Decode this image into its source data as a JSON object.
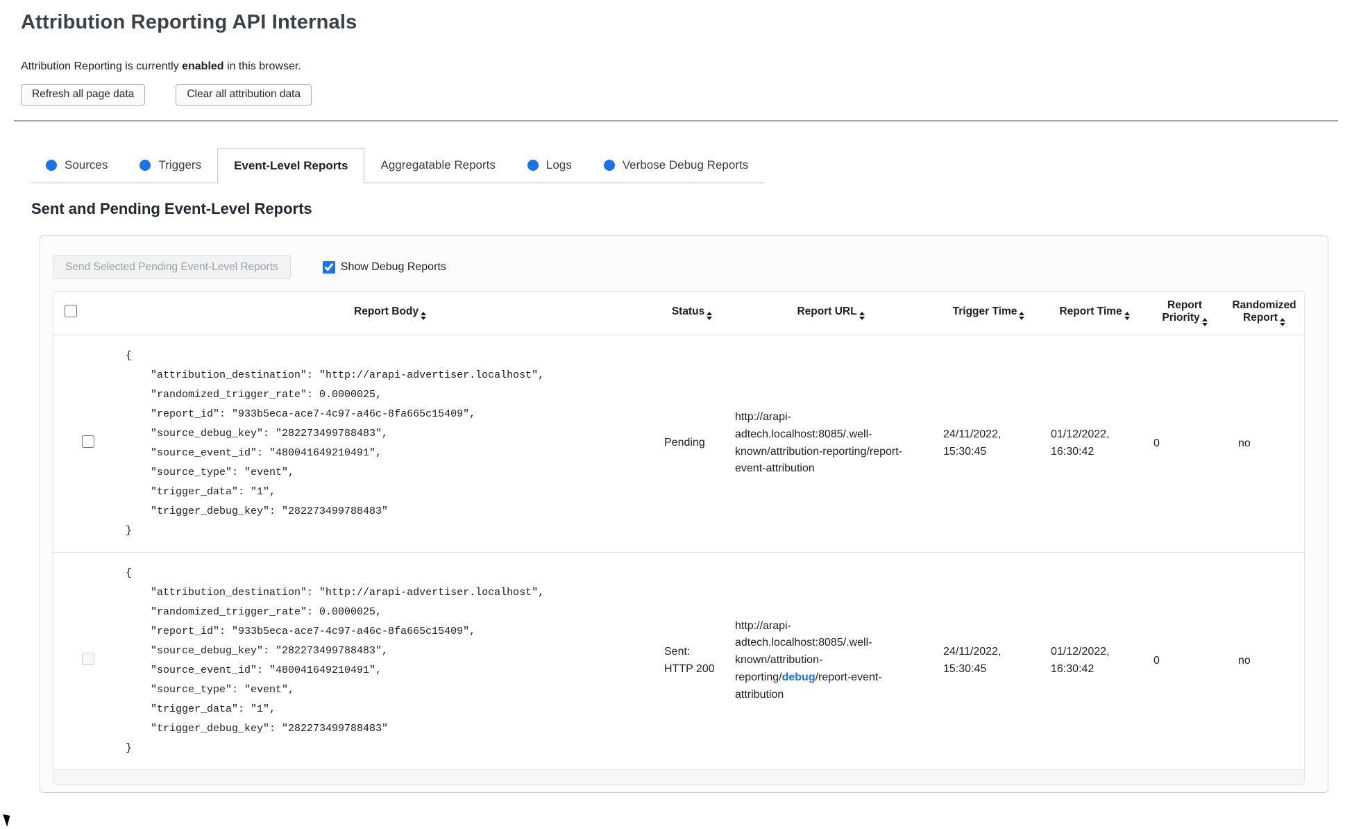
{
  "page": {
    "title": "Attribution Reporting API Internals",
    "intro_prefix": "Attribution Reporting is currently ",
    "intro_bold": "enabled",
    "intro_suffix": " in this browser.",
    "refresh_button": "Refresh all page data",
    "clear_button": "Clear all attribution data"
  },
  "tabs": [
    {
      "label": "Sources",
      "has_dot": true,
      "active": false
    },
    {
      "label": "Triggers",
      "has_dot": true,
      "active": false
    },
    {
      "label": "Event-Level Reports",
      "has_dot": false,
      "active": true
    },
    {
      "label": "Aggregatable Reports",
      "has_dot": false,
      "active": false
    },
    {
      "label": "Logs",
      "has_dot": true,
      "active": false
    },
    {
      "label": "Verbose Debug Reports",
      "has_dot": true,
      "active": false
    }
  ],
  "section": {
    "heading": "Sent and Pending Event-Level Reports",
    "send_button": "Send Selected Pending Event-Level Reports",
    "send_button_disabled": true,
    "show_debug_label": "Show Debug Reports",
    "show_debug_checked": true
  },
  "table": {
    "headers": {
      "body": "Report Body",
      "status": "Status",
      "url": "Report URL",
      "trigger_time": "Trigger Time",
      "report_time": "Report Time",
      "priority": "Report Priority",
      "randomized": "Randomized Report"
    },
    "rows": [
      {
        "selectable": true,
        "body": "{\n    \"attribution_destination\": \"http://arapi-advertiser.localhost\",\n    \"randomized_trigger_rate\": 0.0000025,\n    \"report_id\": \"933b5eca-ace7-4c97-a46c-8fa665c15409\",\n    \"source_debug_key\": \"282273499788483\",\n    \"source_event_id\": \"480041649210491\",\n    \"source_type\": \"event\",\n    \"trigger_data\": \"1\",\n    \"trigger_debug_key\": \"282273499788483\"\n}",
        "status": "Pending",
        "url_prefix": "http://arapi-adtech.localhost:8085/.well-known/attribution-reporting/report-event-attribution",
        "url_debug": "",
        "url_suffix": "",
        "trigger_time": "24/11/2022, 15:30:45",
        "report_time": "01/12/2022, 16:30:42",
        "priority": "0",
        "randomized": "no"
      },
      {
        "selectable": false,
        "body": "{\n    \"attribution_destination\": \"http://arapi-advertiser.localhost\",\n    \"randomized_trigger_rate\": 0.0000025,\n    \"report_id\": \"933b5eca-ace7-4c97-a46c-8fa665c15409\",\n    \"source_debug_key\": \"282273499788483\",\n    \"source_event_id\": \"480041649210491\",\n    \"source_type\": \"event\",\n    \"trigger_data\": \"1\",\n    \"trigger_debug_key\": \"282273499788483\"\n}",
        "status": "Sent: HTTP 200",
        "url_prefix": "http://arapi-adtech.localhost:8085/.well-known/attribution-reporting/",
        "url_debug": "debug",
        "url_suffix": "/report-event-attribution",
        "trigger_time": "24/11/2022, 15:30:45",
        "report_time": "01/12/2022, 16:30:42",
        "priority": "0",
        "randomized": "no"
      }
    ]
  },
  "colors": {
    "accent_blue": "#1a73e8",
    "tab_dot_blue": "#1a73e8",
    "debug_link_blue": "#1a73e8",
    "border_gray": "#e0e0e0"
  }
}
